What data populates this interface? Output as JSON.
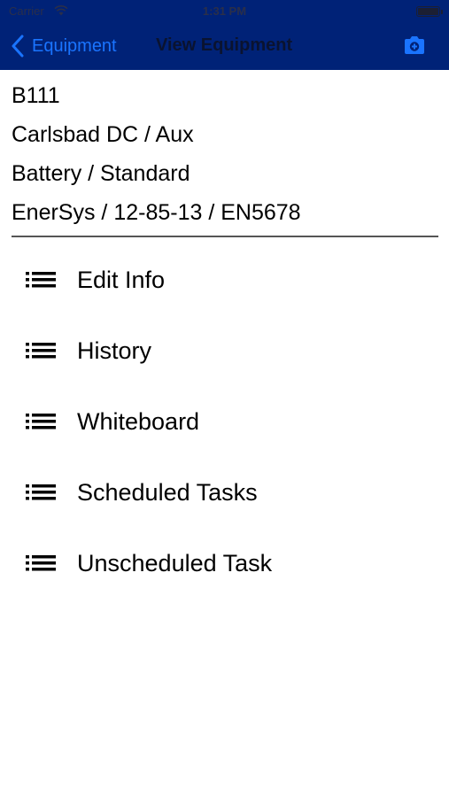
{
  "status_bar": {
    "carrier": "Carrier",
    "time": "1:31 PM"
  },
  "nav": {
    "back_label": "Equipment",
    "title": "View Equipment",
    "back_icon": "chevron-left-icon",
    "action_icon": "camera-icon",
    "bar_color": "#002277",
    "accent_color": "#1a74ff"
  },
  "equipment": {
    "id": "B111",
    "location": "Carlsbad DC / Aux",
    "type": "Battery / Standard",
    "model": "EnerSys / 12-85-13 / EN5678"
  },
  "menu": {
    "icon": "list-icon",
    "items": [
      {
        "label": "Edit Info"
      },
      {
        "label": "History"
      },
      {
        "label": "Whiteboard"
      },
      {
        "label": "Scheduled Tasks"
      },
      {
        "label": "Unscheduled Task"
      }
    ]
  }
}
